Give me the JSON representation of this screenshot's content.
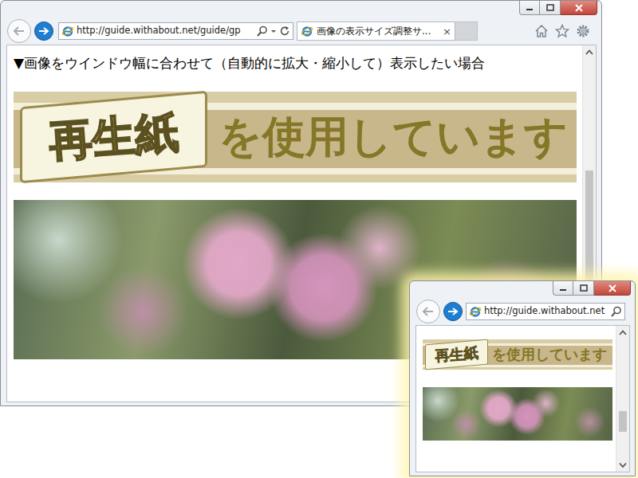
{
  "main_window": {
    "address": "http://guide.withabout.net/guide/gp",
    "tabs": [
      {
        "label": "画像の表示サイズ調整サ...",
        "selected": true
      }
    ],
    "tab_close": "×",
    "page": {
      "heading": "▼画像をウインドウ幅に合わせて（自動的に拡大・縮小して）表示したい場合",
      "banner": {
        "badge": "再生紙",
        "text": "を使用しています"
      }
    }
  },
  "small_window": {
    "address": "http://guide.withabout.net",
    "page": {
      "banner": {
        "badge": "再生紙",
        "text": "を使用しています"
      }
    }
  }
}
